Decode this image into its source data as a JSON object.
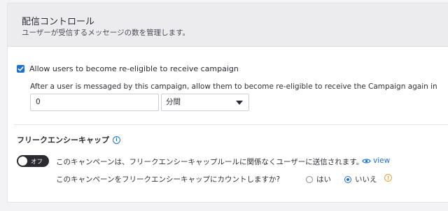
{
  "header": {
    "title": "配信コントロール",
    "subtitle": "ユーザーが受信するメッセージの数を管理します。"
  },
  "reeligibility": {
    "checkbox_label": "Allow users to become re-eligible to receive campaign",
    "checked": true,
    "description": "After a user is messaged by this campaign, allow them to become re-eligible to receive the Campaign again in",
    "input_value": "0",
    "unit_selected": "分間"
  },
  "frequency_cap": {
    "title": "フリークエンシーキャップ",
    "toggle_label": "オフ",
    "toggle_on": false,
    "status_text": "このキャンペーンは、フリークエンシーキャップルールに関係なくユーザーに送信されます。",
    "view_label": "view",
    "count_question": "このキャンペーンをフリークエンシーキャップにカウントしますか?",
    "options": [
      {
        "label": "はい",
        "selected": false
      },
      {
        "label": "いいえ",
        "selected": true
      }
    ]
  },
  "colors": {
    "accent": "#1f6fd1",
    "warning": "#e8a23a",
    "header_bg": "#ececef"
  },
  "icons": {
    "checkbox": "check-icon",
    "info": "info-icon",
    "view": "eye-icon",
    "warning": "warning-icon",
    "select": "caret-down-icon"
  }
}
